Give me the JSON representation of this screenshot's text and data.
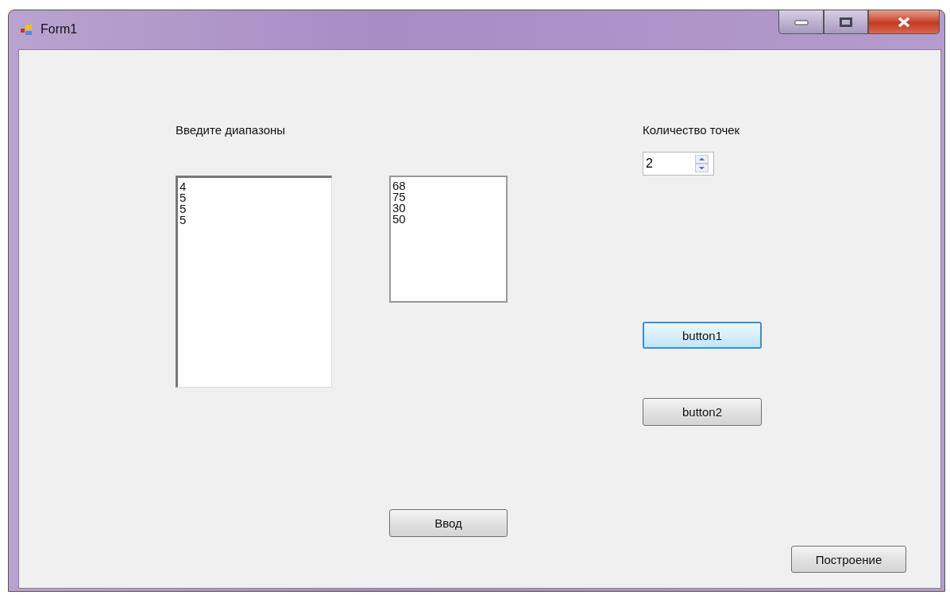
{
  "window": {
    "title": "Form1"
  },
  "ranges_label": "Введите диапазоны",
  "ranges_box": {
    "lines": [
      "4",
      "5",
      "5",
      "5"
    ]
  },
  "values_box": {
    "lines": [
      "68",
      "75",
      "30",
      "50"
    ]
  },
  "points_label": "Количество точек",
  "points_spinner": {
    "value": "2"
  },
  "buttons": [
    {
      "kind": "button1",
      "label": "button1",
      "focused": true
    },
    {
      "kind": "button2",
      "label": "button2",
      "focused": false
    },
    {
      "kind": "enter",
      "label": "Ввод",
      "focused": false
    },
    {
      "kind": "build",
      "label": "Построение",
      "focused": false
    }
  ]
}
